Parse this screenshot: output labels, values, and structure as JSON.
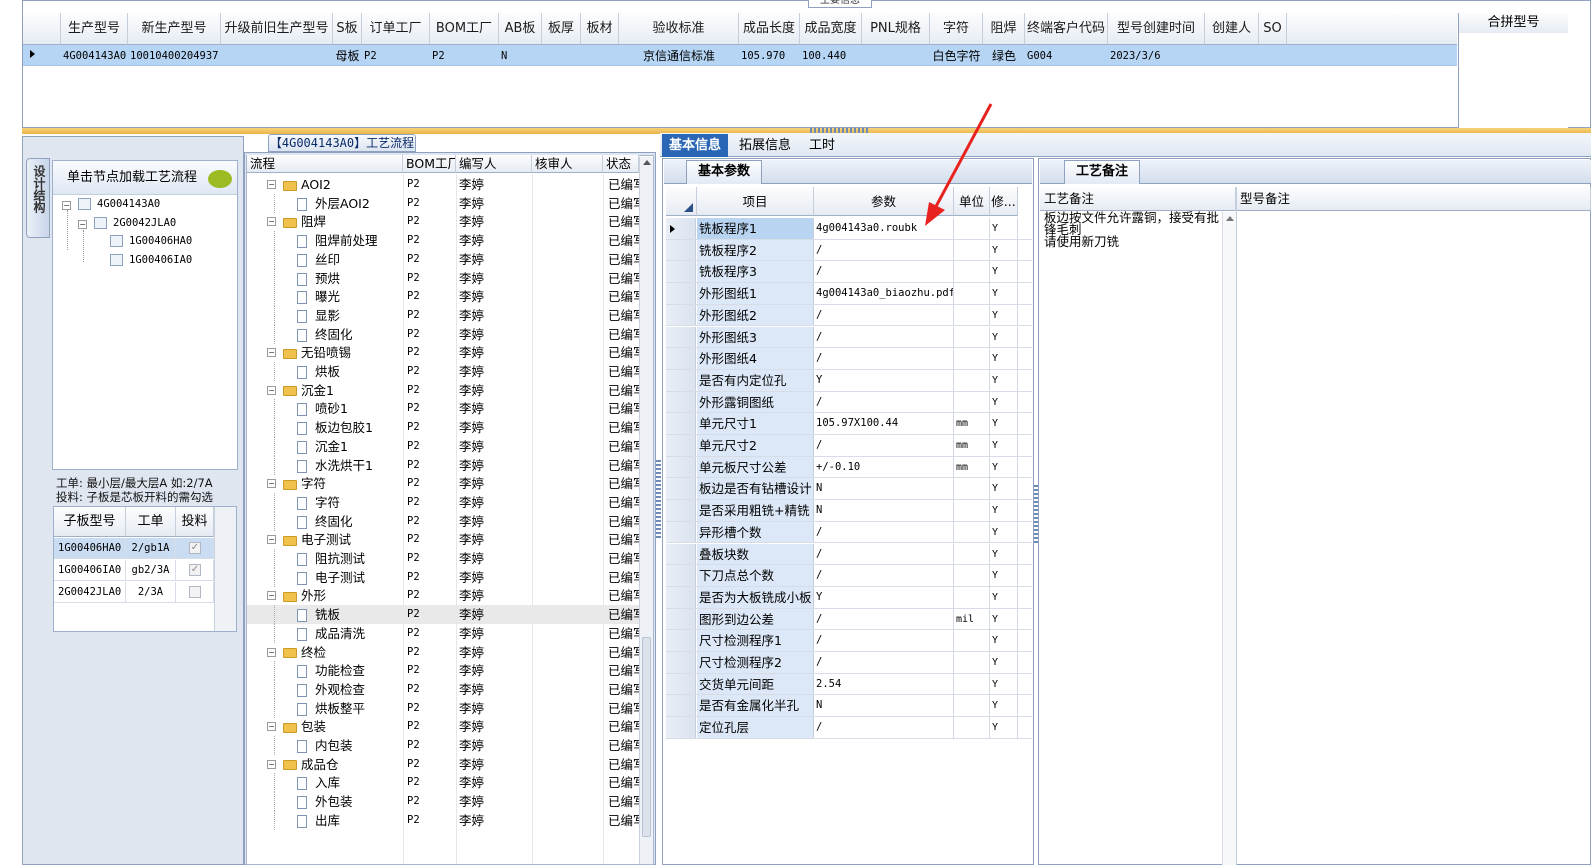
{
  "top_grid": {
    "caption": "主要信息",
    "columns": [
      "生产型号",
      "新生产型号",
      "升级前旧生产型号",
      "S板",
      "订单工厂",
      "BOM工厂",
      "AB板",
      "板厚",
      "板材",
      "验收标准",
      "成品长度",
      "成品宽度",
      "PNL规格",
      "字符",
      "阻焊",
      "终端客户代码",
      "型号创建时间",
      "创建人",
      "SO"
    ],
    "row": {
      "prod_model": "4G004143A0",
      "new_model": "10010400204937",
      "old_model": "",
      "s_board": "母板",
      "order_factory": "P2",
      "bom_factory": "P2",
      "ab_board": "N",
      "thickness": "",
      "material": "",
      "standard": "京信通信标准",
      "length": "105.970",
      "width": "100.440",
      "pnl": "",
      "character": "白色字符",
      "solder_mask": "绿色",
      "customer_code": "G004",
      "created_time": "2023/3/6",
      "creator": "",
      "so": ""
    },
    "right_header": "合拼型号"
  },
  "left_panel": {
    "vertical_tab": "设计结构",
    "load_hint": "单击节点加载工艺流程",
    "tree": [
      {
        "label": "4G004143A0",
        "level": 0
      },
      {
        "label": "2G0042JLA0",
        "level": 1
      },
      {
        "label": "1G00406HA0",
        "level": 2
      },
      {
        "label": "1G00406IA0",
        "level": 2
      }
    ],
    "note_line1": "工单: 最小层/最大层A 如:2/7A",
    "note_line2": "投料: 子板是芯板开料的需勾选",
    "sub_columns": [
      "子板型号",
      "工单",
      "投料"
    ],
    "sub_rows": [
      {
        "model": "1G00406HA0",
        "order": "2/gb1A",
        "feed": true
      },
      {
        "model": "1G00406IA0",
        "order": "gb2/3A",
        "feed": true
      },
      {
        "model": "2G0042JLA0",
        "order": "2/3A",
        "feed": false
      }
    ]
  },
  "process_panel": {
    "title": "【4G004143A0】工艺流程",
    "columns": [
      "流程",
      "BOM工厂",
      "编写人",
      "核审人",
      "状态"
    ],
    "rows": [
      {
        "name": "AOI2",
        "type": "folder",
        "bom": "P2",
        "author": "李婷",
        "status": "已编写"
      },
      {
        "name": "外层AOI2",
        "type": "doc",
        "bom": "P2",
        "author": "李婷",
        "status": "已编写"
      },
      {
        "name": "阻焊",
        "type": "folder",
        "bom": "P2",
        "author": "李婷",
        "status": "已编写"
      },
      {
        "name": "阻焊前处理",
        "type": "doc",
        "bom": "P2",
        "author": "李婷",
        "status": "已编写"
      },
      {
        "name": "丝印",
        "type": "doc",
        "bom": "P2",
        "author": "李婷",
        "status": "已编写"
      },
      {
        "name": "预烘",
        "type": "doc",
        "bom": "P2",
        "author": "李婷",
        "status": "已编写"
      },
      {
        "name": "曝光",
        "type": "doc",
        "bom": "P2",
        "author": "李婷",
        "status": "已编写"
      },
      {
        "name": "显影",
        "type": "doc",
        "bom": "P2",
        "author": "李婷",
        "status": "已编写"
      },
      {
        "name": "终固化",
        "type": "doc",
        "bom": "P2",
        "author": "李婷",
        "status": "已编写"
      },
      {
        "name": "无铅喷锡",
        "type": "folder",
        "bom": "P2",
        "author": "李婷",
        "status": "已编写"
      },
      {
        "name": "烘板",
        "type": "doc",
        "bom": "P2",
        "author": "李婷",
        "status": "已编写"
      },
      {
        "name": "沉金1",
        "type": "folder",
        "bom": "P2",
        "author": "李婷",
        "status": "已编写"
      },
      {
        "name": "喷砂1",
        "type": "doc",
        "bom": "P2",
        "author": "李婷",
        "status": "已编写"
      },
      {
        "name": "板边包胶1",
        "type": "doc",
        "bom": "P2",
        "author": "李婷",
        "status": "已编写"
      },
      {
        "name": "沉金1",
        "type": "doc",
        "bom": "P2",
        "author": "李婷",
        "status": "已编写"
      },
      {
        "name": "水洗烘干1",
        "type": "doc",
        "bom": "P2",
        "author": "李婷",
        "status": "已编写"
      },
      {
        "name": "字符",
        "type": "folder",
        "bom": "P2",
        "author": "李婷",
        "status": "已编写"
      },
      {
        "name": "字符",
        "type": "doc",
        "bom": "P2",
        "author": "李婷",
        "status": "已编写"
      },
      {
        "name": "终固化",
        "type": "doc",
        "bom": "P2",
        "author": "李婷",
        "status": "已编写"
      },
      {
        "name": "电子测试",
        "type": "folder",
        "bom": "P2",
        "author": "李婷",
        "status": "已编写"
      },
      {
        "name": "阻抗测试",
        "type": "doc",
        "bom": "P2",
        "author": "李婷",
        "status": "已编写"
      },
      {
        "name": "电子测试",
        "type": "doc",
        "bom": "P2",
        "author": "李婷",
        "status": "已编写"
      },
      {
        "name": "外形",
        "type": "folder",
        "bom": "P2",
        "author": "李婷",
        "status": "已编写"
      },
      {
        "name": "铣板",
        "type": "doc",
        "bom": "P2",
        "author": "李婷",
        "status": "已编写",
        "selected": true
      },
      {
        "name": "成品清洗",
        "type": "doc",
        "bom": "P2",
        "author": "李婷",
        "status": "已编写"
      },
      {
        "name": "终检",
        "type": "folder",
        "bom": "P2",
        "author": "李婷",
        "status": "已编写"
      },
      {
        "name": "功能检查",
        "type": "doc",
        "bom": "P2",
        "author": "李婷",
        "status": "已编写"
      },
      {
        "name": "外观检查",
        "type": "doc",
        "bom": "P2",
        "author": "李婷",
        "status": "已编写"
      },
      {
        "name": "烘板整平",
        "type": "doc",
        "bom": "P2",
        "author": "李婷",
        "status": "已编写"
      },
      {
        "name": "包装",
        "type": "folder",
        "bom": "P2",
        "author": "李婷",
        "status": "已编写"
      },
      {
        "name": "内包装",
        "type": "doc",
        "bom": "P2",
        "author": "李婷",
        "status": "已编写"
      },
      {
        "name": "成品仓",
        "type": "folder",
        "bom": "P2",
        "author": "李婷",
        "status": "已编写"
      },
      {
        "name": "入库",
        "type": "doc",
        "bom": "P2",
        "author": "李婷",
        "status": "已编写"
      },
      {
        "name": "外包装",
        "type": "doc",
        "bom": "P2",
        "author": "李婷",
        "status": "已编写"
      },
      {
        "name": "出库",
        "type": "doc",
        "bom": "P2",
        "author": "李婷",
        "status": "已编写"
      }
    ]
  },
  "detail_tabs": [
    "基本信息",
    "拓展信息",
    "工时"
  ],
  "basic_params": {
    "tab": "基本参数",
    "columns": [
      "项目",
      "参数",
      "单位",
      "修..."
    ],
    "rows": [
      {
        "item": "铣板程序1",
        "value": "4g004143a0.roubk",
        "unit": "",
        "mod": "Y"
      },
      {
        "item": "铣板程序2",
        "value": "/",
        "unit": "",
        "mod": "Y"
      },
      {
        "item": "铣板程序3",
        "value": "/",
        "unit": "",
        "mod": "Y"
      },
      {
        "item": "外形图纸1",
        "value": "4g004143a0_biaozhu.pdf",
        "unit": "",
        "mod": "Y"
      },
      {
        "item": "外形图纸2",
        "value": "/",
        "unit": "",
        "mod": "Y"
      },
      {
        "item": "外形图纸3",
        "value": "/",
        "unit": "",
        "mod": "Y"
      },
      {
        "item": "外形图纸4",
        "value": "/",
        "unit": "",
        "mod": "Y"
      },
      {
        "item": "是否有内定位孔",
        "value": "Y",
        "unit": "",
        "mod": "Y"
      },
      {
        "item": "外形露铜图纸",
        "value": "/",
        "unit": "",
        "mod": "Y"
      },
      {
        "item": "单元尺寸1",
        "value": "105.97X100.44",
        "unit": "mm",
        "mod": "Y"
      },
      {
        "item": "单元尺寸2",
        "value": "/",
        "unit": "mm",
        "mod": "Y"
      },
      {
        "item": "单元板尺寸公差",
        "value": "+/-0.10",
        "unit": "mm",
        "mod": "Y"
      },
      {
        "item": "板边是否有钻槽设计",
        "value": "N",
        "unit": "",
        "mod": "Y"
      },
      {
        "item": "是否采用粗铣+精铣",
        "value": "N",
        "unit": "",
        "mod": "Y"
      },
      {
        "item": "异形槽个数",
        "value": "/",
        "unit": "",
        "mod": "Y"
      },
      {
        "item": "叠板块数",
        "value": "/",
        "unit": "",
        "mod": "Y"
      },
      {
        "item": "下刀点总个数",
        "value": "/",
        "unit": "",
        "mod": "Y"
      },
      {
        "item": "是否为大板铣成小板",
        "value": "Y",
        "unit": "",
        "mod": "Y"
      },
      {
        "item": "图形到边公差",
        "value": "/",
        "unit": "mil",
        "mod": "Y"
      },
      {
        "item": "尺寸检测程序1",
        "value": "/",
        "unit": "",
        "mod": "Y"
      },
      {
        "item": "尺寸检测程序2",
        "value": "/",
        "unit": "",
        "mod": "Y"
      },
      {
        "item": "交货单元间距",
        "value": "2.54",
        "unit": "",
        "mod": "Y"
      },
      {
        "item": "是否有金属化半孔",
        "value": "N",
        "unit": "",
        "mod": "Y"
      },
      {
        "item": "定位孔层",
        "value": "/",
        "unit": "",
        "mod": "Y"
      }
    ]
  },
  "notes_panel": {
    "tab": "工艺备注",
    "col1": "工艺备注",
    "col2": "型号备注",
    "text_line1": "板边按文件允许露铜，接受有批",
    "text_line2": "锋毛刺",
    "text_line3": "请使用新刀铣"
  },
  "colors": {
    "accent": "#2a66b6",
    "selection": "#b6d5f4",
    "arrow": "#e8231f",
    "separator": "#eab54a"
  }
}
